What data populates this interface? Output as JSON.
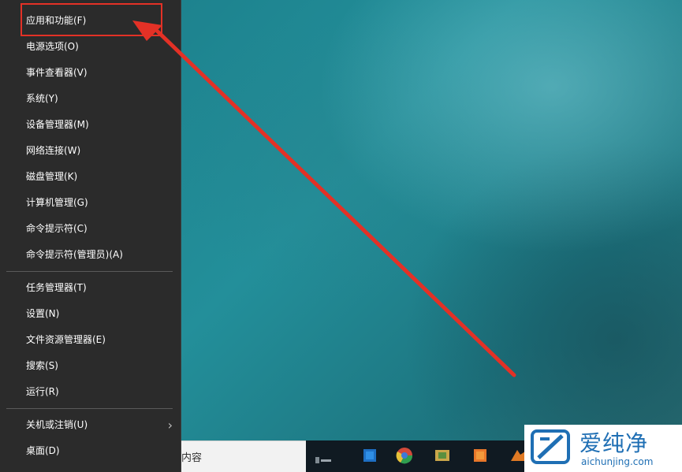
{
  "menu": {
    "items": [
      {
        "label": "应用和功能(F)",
        "name": "menu-item-apps-features",
        "highlighted": true
      },
      {
        "label": "电源选项(O)",
        "name": "menu-item-power-options"
      },
      {
        "label": "事件查看器(V)",
        "name": "menu-item-event-viewer"
      },
      {
        "label": "系统(Y)",
        "name": "menu-item-system"
      },
      {
        "label": "设备管理器(M)",
        "name": "menu-item-device-manager"
      },
      {
        "label": "网络连接(W)",
        "name": "menu-item-network-connections"
      },
      {
        "label": "磁盘管理(K)",
        "name": "menu-item-disk-management"
      },
      {
        "label": "计算机管理(G)",
        "name": "menu-item-computer-management"
      },
      {
        "label": "命令提示符(C)",
        "name": "menu-item-command-prompt"
      },
      {
        "label": "命令提示符(管理员)(A)",
        "name": "menu-item-command-prompt-admin"
      },
      {
        "separator": true
      },
      {
        "label": "任务管理器(T)",
        "name": "menu-item-task-manager"
      },
      {
        "label": "设置(N)",
        "name": "menu-item-settings"
      },
      {
        "label": "文件资源管理器(E)",
        "name": "menu-item-file-explorer"
      },
      {
        "label": "搜索(S)",
        "name": "menu-item-search"
      },
      {
        "label": "运行(R)",
        "name": "menu-item-run"
      },
      {
        "separator": true
      },
      {
        "label": "关机或注销(U)",
        "name": "menu-item-shutdown-signout",
        "submenu": true
      },
      {
        "label": "桌面(D)",
        "name": "menu-item-desktop"
      }
    ],
    "submenu_glyph": "›"
  },
  "taskbar": {
    "search_text": "内容",
    "icons": [
      "task-view-icon",
      "store-icon",
      "chrome-icon",
      "app-icon",
      "files-icon",
      "folder-icon"
    ]
  },
  "watermark": {
    "title": "爱纯净",
    "url": "aichunjing.com"
  },
  "annotation": {
    "color": "#e33126"
  }
}
